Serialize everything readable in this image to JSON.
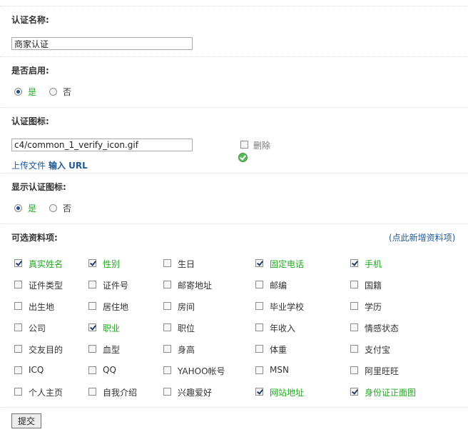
{
  "verify_name": {
    "label": "认证名称:",
    "value": "商家认证"
  },
  "enabled": {
    "label": "是否启用:",
    "yes": "是",
    "no": "否",
    "selected": "yes"
  },
  "verify_icon": {
    "label": "认证图标:",
    "value": "c4/common_1_verify_icon.gif",
    "delete_label": "删除",
    "upload_link": "上传文件",
    "input_url_link": "输入 URL"
  },
  "show_icon": {
    "label": "显示认证图标:",
    "yes": "是",
    "no": "否",
    "selected": "yes"
  },
  "fields": {
    "label": "可选资料项:",
    "add_link": "(点此新增资料项)",
    "rows": [
      [
        {
          "label": "真实姓名",
          "checked": true
        },
        {
          "label": "性别",
          "checked": true
        },
        {
          "label": "生日",
          "checked": false
        },
        {
          "label": "固定电话",
          "checked": true
        },
        {
          "label": "手机",
          "checked": true
        }
      ],
      [
        {
          "label": "证件类型",
          "checked": false
        },
        {
          "label": "证件号",
          "checked": false
        },
        {
          "label": "邮寄地址",
          "checked": false
        },
        {
          "label": "邮编",
          "checked": false
        },
        {
          "label": "国籍",
          "checked": false
        }
      ],
      [
        {
          "label": "出生地",
          "checked": false
        },
        {
          "label": "居住地",
          "checked": false
        },
        {
          "label": "房间",
          "checked": false
        },
        {
          "label": "毕业学校",
          "checked": false
        },
        {
          "label": "学历",
          "checked": false
        }
      ],
      [
        {
          "label": "公司",
          "checked": false
        },
        {
          "label": "职业",
          "checked": true
        },
        {
          "label": "职位",
          "checked": false
        },
        {
          "label": "年收入",
          "checked": false
        },
        {
          "label": "情感状态",
          "checked": false
        }
      ],
      [
        {
          "label": "交友目的",
          "checked": false
        },
        {
          "label": "血型",
          "checked": false
        },
        {
          "label": "身高",
          "checked": false
        },
        {
          "label": "体重",
          "checked": false
        },
        {
          "label": "支付宝",
          "checked": false
        }
      ],
      [
        {
          "label": "ICQ",
          "checked": false
        },
        {
          "label": "QQ",
          "checked": false
        },
        {
          "label": "YAHOO帐号",
          "checked": false
        },
        {
          "label": "MSN",
          "checked": false
        },
        {
          "label": "阿里旺旺",
          "checked": false
        }
      ],
      [
        {
          "label": "个人主页",
          "checked": false
        },
        {
          "label": "自我介绍",
          "checked": false
        },
        {
          "label": "兴趣爱好",
          "checked": false
        },
        {
          "label": "网站地址",
          "checked": true
        },
        {
          "label": "身份证正面图",
          "checked": true
        }
      ]
    ]
  },
  "submit_label": "提交",
  "colors": {
    "checked_label": "#22aa22",
    "link": "#1f5a96"
  }
}
